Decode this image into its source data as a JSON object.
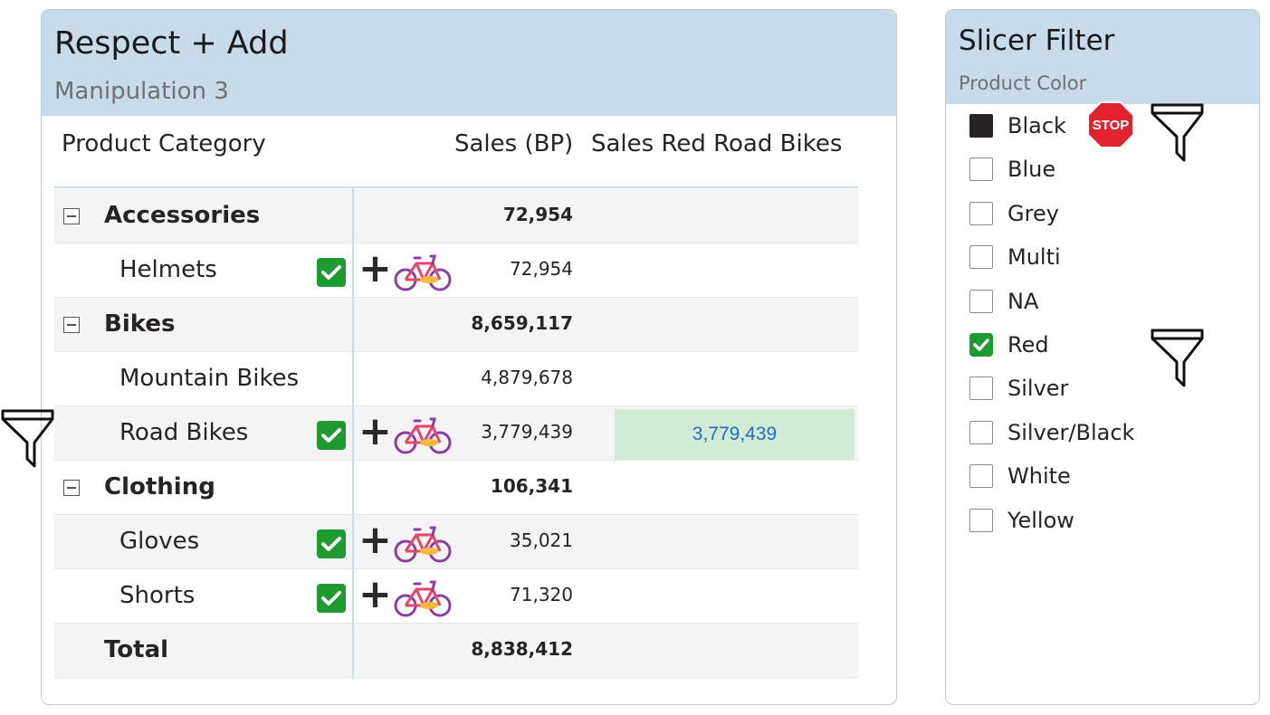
{
  "matrix": {
    "title": "Respect + Add",
    "subtitle": "Manipulation 3",
    "headers": {
      "category": "Product Category",
      "sales": "Sales (BP)",
      "sales_red": "Sales Red Road Bikes"
    },
    "rows": [
      {
        "label": "Accessories",
        "value": "72,954",
        "level": "group"
      },
      {
        "label": "Helmets",
        "value": "72,954",
        "level": "item",
        "annotated": true
      },
      {
        "label": "Bikes",
        "value": "8,659,117",
        "level": "group"
      },
      {
        "label": "Mountain Bikes",
        "value": "4,879,678",
        "level": "item"
      },
      {
        "label": "Road Bikes",
        "value": "3,779,439",
        "level": "item",
        "annotated": true,
        "red_value": "3,779,439"
      },
      {
        "label": "Clothing",
        "value": "106,341",
        "level": "group"
      },
      {
        "label": "Gloves",
        "value": "35,021",
        "level": "item",
        "annotated": true
      },
      {
        "label": "Shorts",
        "value": "71,320",
        "level": "item",
        "annotated": true
      },
      {
        "label": "Total",
        "value": "8,838,412",
        "level": "total"
      }
    ],
    "annotation_icons": [
      "check-icon",
      "plus-icon",
      "bike-icon"
    ],
    "highlight_color": "#d2ebd5",
    "highlight_text_color": "#1e6ccf"
  },
  "slicer": {
    "title": "Slicer Filter",
    "subtitle": "Product Color",
    "items": [
      {
        "label": "Black",
        "state": "filled"
      },
      {
        "label": "Blue",
        "state": "unchecked"
      },
      {
        "label": "Grey",
        "state": "unchecked"
      },
      {
        "label": "Multi",
        "state": "unchecked"
      },
      {
        "label": "NA",
        "state": "unchecked"
      },
      {
        "label": "Red",
        "state": "checked"
      },
      {
        "label": "Silver",
        "state": "unchecked"
      },
      {
        "label": "Silver/Black",
        "state": "unchecked"
      },
      {
        "label": "White",
        "state": "unchecked"
      },
      {
        "label": "Yellow",
        "state": "unchecked"
      }
    ],
    "stop_label": "STOP"
  },
  "colors": {
    "header_bg": "#c8dbe8",
    "check_green": "#1d9a30",
    "stop_red": "#e0232e"
  }
}
